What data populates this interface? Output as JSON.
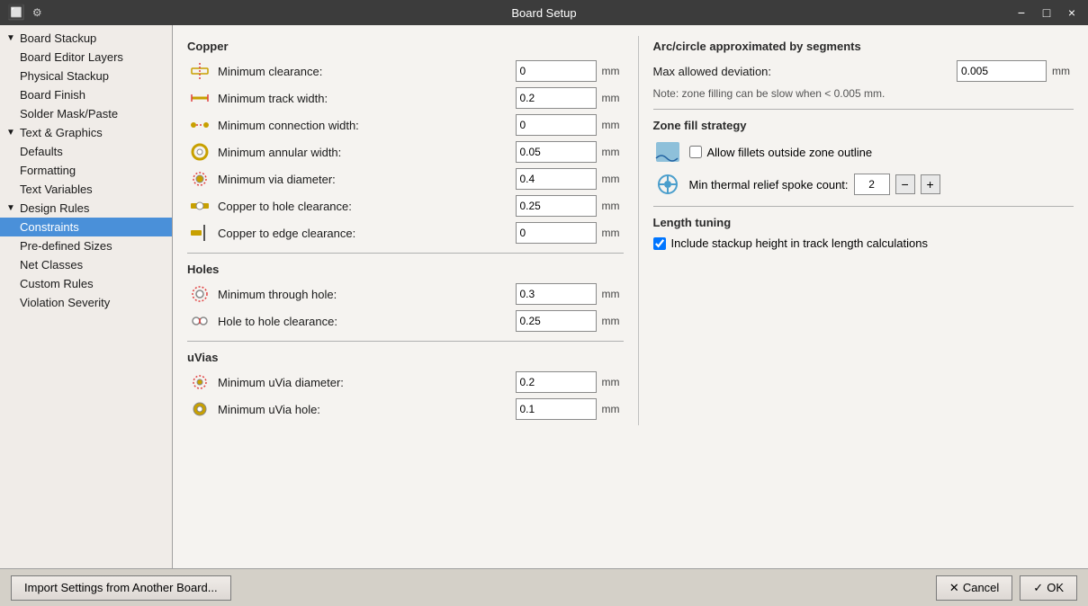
{
  "app": {
    "title": "Board Setup",
    "icon": "🔲"
  },
  "titlebar": {
    "controls": [
      "−",
      "□",
      "×"
    ]
  },
  "sidebar": {
    "sections": [
      {
        "id": "board-stackup",
        "label": "Board Stackup",
        "expanded": true,
        "indent": "category",
        "children": [
          {
            "id": "board-editor-layers",
            "label": "Board Editor Layers",
            "indent": "sub"
          },
          {
            "id": "physical-stackup",
            "label": "Physical Stackup",
            "indent": "sub"
          },
          {
            "id": "board-finish",
            "label": "Board Finish",
            "indent": "sub"
          },
          {
            "id": "solder-mask-paste",
            "label": "Solder Mask/Paste",
            "indent": "sub"
          }
        ]
      },
      {
        "id": "text-graphics",
        "label": "Text & Graphics",
        "expanded": true,
        "indent": "category",
        "children": [
          {
            "id": "defaults",
            "label": "Defaults",
            "indent": "sub"
          },
          {
            "id": "formatting",
            "label": "Formatting",
            "indent": "sub"
          },
          {
            "id": "text-variables",
            "label": "Text Variables",
            "indent": "sub"
          }
        ]
      },
      {
        "id": "design-rules",
        "label": "Design Rules",
        "expanded": true,
        "indent": "category",
        "children": [
          {
            "id": "constraints",
            "label": "Constraints",
            "indent": "sub",
            "active": true
          },
          {
            "id": "pre-defined-sizes",
            "label": "Pre-defined Sizes",
            "indent": "sub"
          },
          {
            "id": "net-classes",
            "label": "Net Classes",
            "indent": "sub"
          },
          {
            "id": "custom-rules",
            "label": "Custom Rules",
            "indent": "sub"
          },
          {
            "id": "violation-severity",
            "label": "Violation Severity",
            "indent": "sub"
          }
        ]
      }
    ]
  },
  "main": {
    "sections": {
      "copper": {
        "title": "Copper",
        "rows": [
          {
            "id": "min-clearance",
            "label": "Minimum clearance:",
            "value": "0",
            "unit": "mm",
            "icon": "clearance"
          },
          {
            "id": "min-track-width",
            "label": "Minimum track width:",
            "value": "0.2",
            "unit": "mm",
            "icon": "track"
          },
          {
            "id": "min-connection-width",
            "label": "Minimum connection width:",
            "value": "0",
            "unit": "mm",
            "icon": "connection"
          },
          {
            "id": "min-annular-width",
            "label": "Minimum annular width:",
            "value": "0.05",
            "unit": "mm",
            "icon": "annular"
          },
          {
            "id": "min-via-diameter",
            "label": "Minimum via diameter:",
            "value": "0.4",
            "unit": "mm",
            "icon": "via"
          },
          {
            "id": "copper-to-hole",
            "label": "Copper to hole clearance:",
            "value": "0.25",
            "unit": "mm",
            "icon": "copphole"
          },
          {
            "id": "copper-to-edge",
            "label": "Copper to edge clearance:",
            "value": "0",
            "unit": "mm",
            "icon": "coppedge"
          }
        ]
      },
      "holes": {
        "title": "Holes",
        "rows": [
          {
            "id": "min-through-hole",
            "label": "Minimum through hole:",
            "value": "0.3",
            "unit": "mm",
            "icon": "throughhole"
          },
          {
            "id": "hole-to-hole",
            "label": "Hole to hole clearance:",
            "value": "0.25",
            "unit": "mm",
            "icon": "holeclear"
          }
        ]
      },
      "uvias": {
        "title": "uVias",
        "rows": [
          {
            "id": "min-uvia-diameter",
            "label": "Minimum uVia diameter:",
            "value": "0.2",
            "unit": "mm",
            "icon": "uvia"
          },
          {
            "id": "min-uvia-hole",
            "label": "Minimum uVia hole:",
            "value": "0.1",
            "unit": "mm",
            "icon": "uviahol"
          }
        ]
      }
    },
    "right": {
      "arc_section": {
        "title": "Arc/circle approximated by segments",
        "max_deviation_label": "Max allowed deviation:",
        "max_deviation_value": "0.005",
        "max_deviation_unit": "mm",
        "note": "Note: zone filling can be slow when < 0.005 mm."
      },
      "zone_fill": {
        "title": "Zone fill strategy",
        "allow_fillets_label": "Allow fillets outside zone outline",
        "allow_fillets_checked": false,
        "min_spoke_label": "Min thermal relief spoke count:",
        "min_spoke_value": "2"
      },
      "length_tuning": {
        "title": "Length tuning",
        "include_stackup_label": "Include stackup height in track length calculations",
        "include_stackup_checked": true
      }
    }
  },
  "bottom": {
    "import_button": "Import Settings from Another Board...",
    "cancel_button": "Cancel",
    "ok_button": "OK"
  }
}
